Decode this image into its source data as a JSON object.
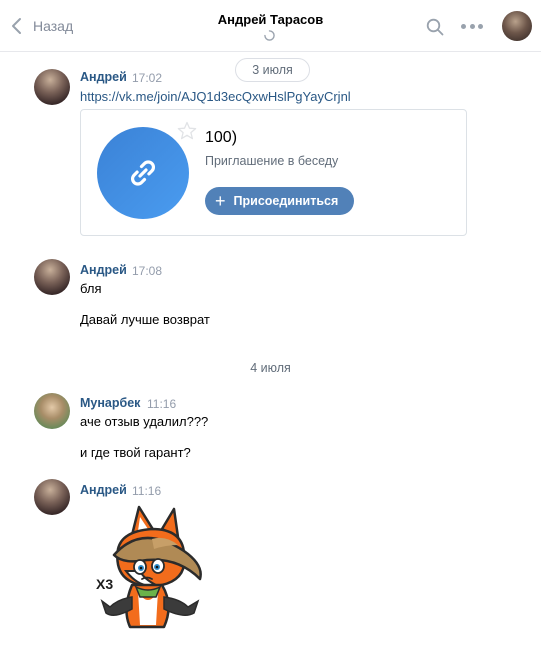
{
  "header": {
    "back_label": "Назад",
    "chat_title": "Андрей Тарасов"
  },
  "dates": {
    "first": "3 июля",
    "second": "4 июля"
  },
  "messages": [
    {
      "author": "Андрей",
      "time": "17:02",
      "link": "https://vk.me/join/AJQ1d3ecQxwHslPgYayCrjnl",
      "invite_card": {
        "title": "100)",
        "subtitle": "Приглашение в беседу",
        "button_label": "Присоединиться"
      }
    },
    {
      "author": "Андрей",
      "time": "17:08",
      "lines": [
        "бля",
        "Давай лучше возврат"
      ]
    },
    {
      "author": "Мунарбек",
      "time": "11:16",
      "lines": [
        "аче отзыв удалил???",
        "и где твой гарант?"
      ]
    },
    {
      "author": "Андрей",
      "time": "11:16",
      "sticker": {
        "caption": "X3",
        "icon": "fox-shrug-sticker"
      }
    }
  ],
  "colors": {
    "link": "#2a5885",
    "button": "#5181b8",
    "muted": "#939cab"
  }
}
